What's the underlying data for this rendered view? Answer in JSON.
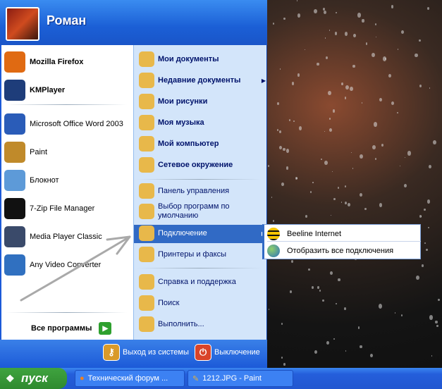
{
  "user": {
    "name": "Роман"
  },
  "pinned": [
    {
      "label": "Mozilla Firefox",
      "bold": true,
      "icon": "firefox-icon",
      "color": "#e06a12"
    },
    {
      "label": "KMPlayer",
      "bold": true,
      "icon": "kmplayer-icon",
      "color": "#1e3d7a"
    }
  ],
  "recent": [
    {
      "label": "Microsoft Office Word 2003",
      "icon": "word-icon",
      "color": "#2a5cb8"
    },
    {
      "label": "Paint",
      "icon": "paint-icon",
      "color": "#c08a2a"
    },
    {
      "label": "Блокнот",
      "icon": "notepad-icon",
      "color": "#5d9ad8"
    },
    {
      "label": "7-Zip File Manager",
      "icon": "7zip-icon",
      "color": "#111111"
    },
    {
      "label": "Media Player Classic",
      "icon": "media-player-icon",
      "color": "#3a4a6a"
    },
    {
      "label": "Any Video Converter",
      "icon": "video-converter-icon",
      "color": "#3070c0"
    }
  ],
  "all_programs": "Все программы",
  "places": [
    {
      "label": "Мои документы",
      "icon": "folder-docs-icon"
    },
    {
      "label": "Недавние документы",
      "icon": "recent-docs-icon",
      "submenu": true
    },
    {
      "label": "Мои рисунки",
      "icon": "folder-pictures-icon"
    },
    {
      "label": "Моя музыка",
      "icon": "folder-music-icon"
    },
    {
      "label": "Мой компьютер",
      "icon": "computer-icon"
    },
    {
      "label": "Сетевое окружение",
      "icon": "network-icon"
    }
  ],
  "system": [
    {
      "label": "Панель управления",
      "icon": "control-panel-icon"
    },
    {
      "label": "Выбор программ по умолчанию",
      "icon": "default-programs-icon"
    },
    {
      "label": "Подключение",
      "icon": "connect-icon",
      "submenu": true
    },
    {
      "label": "Принтеры и факсы",
      "icon": "printer-icon"
    }
  ],
  "help": [
    {
      "label": "Справка и поддержка",
      "icon": "help-icon"
    },
    {
      "label": "Поиск",
      "icon": "search-icon"
    },
    {
      "label": "Выполнить...",
      "icon": "run-icon"
    }
  ],
  "submenu": [
    "Beeline Internet",
    "Отобразить все подключения"
  ],
  "footer": {
    "logoff": "Выход из системы",
    "shutdown": "Выключение"
  },
  "taskbar": {
    "start": "пуск",
    "tasks": [
      "Технический форум ...",
      "1212.JPG - Paint"
    ]
  }
}
